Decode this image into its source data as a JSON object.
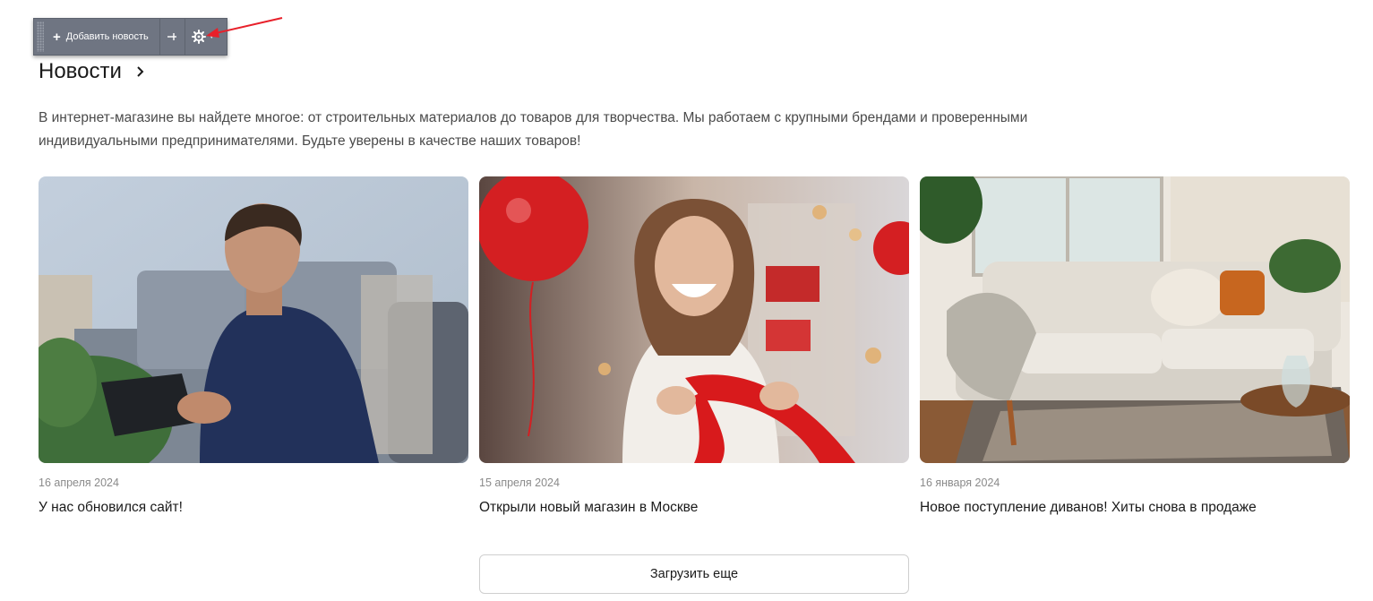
{
  "admin_toolbar": {
    "add_label": "Добавить новость",
    "icons": [
      "plus-icon",
      "pin-icon",
      "gear-icon",
      "caret-down-icon"
    ]
  },
  "section": {
    "title": "Новости",
    "description": "В интернет-магазине вы найдете многое: от строительных материалов до товаров для творчества. Мы работаем с крупными брендами и проверенными индивидуальными предпринимателями. Будьте уверены в качестве наших товаров!"
  },
  "news": [
    {
      "date": "16 апреля 2024",
      "title": "У нас обновился сайт!"
    },
    {
      "date": "15 апреля 2024",
      "title": "Открыли новый магазин в Москве"
    },
    {
      "date": "16 января 2024",
      "title": "Новое поступление диванов! Хиты снова в продаже"
    }
  ],
  "load_more_label": "Загрузить еще",
  "colors": {
    "toolbar_bg": "#6f7582",
    "annotation_arrow": "#e8202a",
    "text_primary": "#1a1a1a",
    "text_muted": "#8a8a8a"
  }
}
